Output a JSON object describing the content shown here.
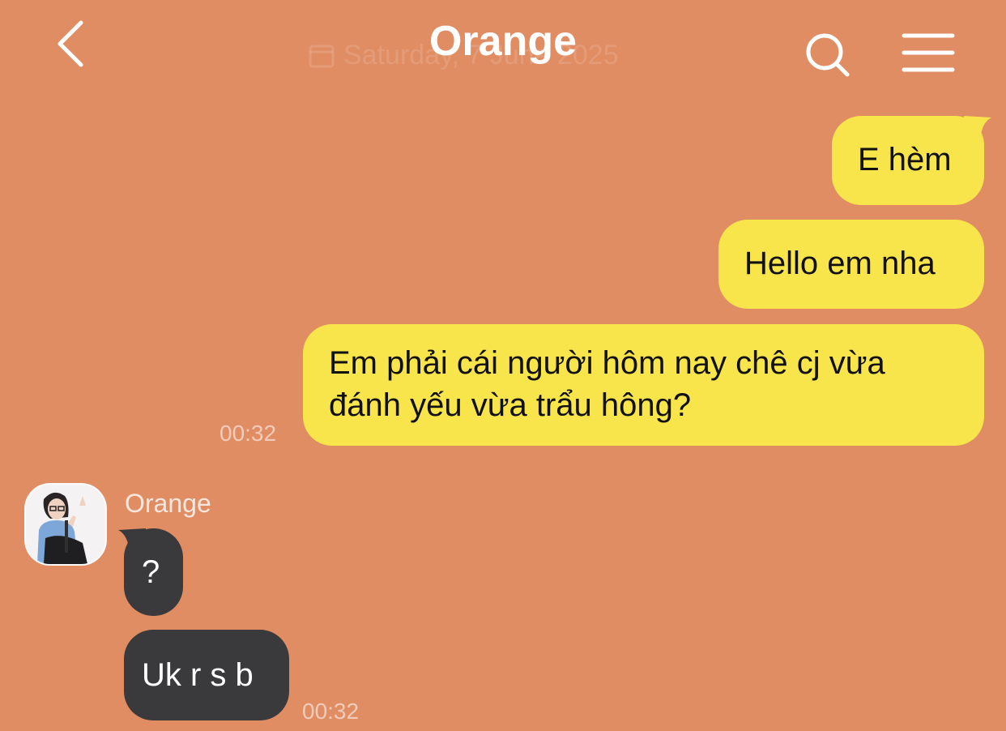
{
  "header": {
    "title": "Orange",
    "date_label": "Saturday, 7 June 2025",
    "back_icon": "chevron-left-icon",
    "search_icon": "search-icon",
    "menu_icon": "hamburger-menu-icon",
    "calendar_icon": "calendar-icon"
  },
  "colors": {
    "background": "#E08D64",
    "outgoing_bubble": "#F8E44B",
    "incoming_bubble": "#3A3A3C"
  },
  "messages": {
    "outgoing": [
      {
        "text": "E hèm"
      },
      {
        "text": "Hello em nha"
      },
      {
        "text": "Em phải cái người hôm nay chê cj vừa đánh yếu vừa trẩu hông?"
      }
    ],
    "outgoing_time": "00:32",
    "incoming_sender": "Orange",
    "incoming": [
      {
        "text": "?"
      },
      {
        "text": "Uk r s b"
      }
    ],
    "incoming_time": "00:32"
  }
}
